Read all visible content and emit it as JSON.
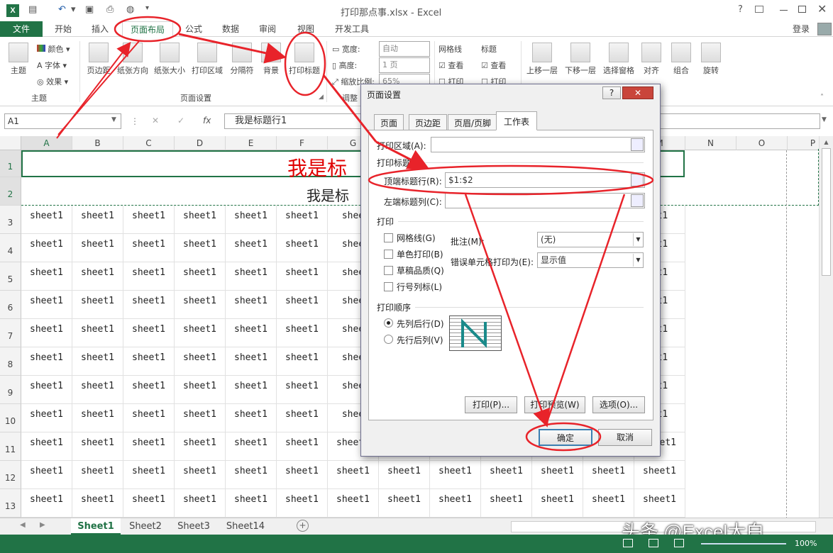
{
  "window": {
    "title": "打印那点事.xlsx - Excel",
    "help_label": "?",
    "login_label": "登录"
  },
  "ribbon_tabs": [
    {
      "label": "文件"
    },
    {
      "label": "开始"
    },
    {
      "label": "插入"
    },
    {
      "label": "页面布局"
    },
    {
      "label": "公式"
    },
    {
      "label": "数据"
    },
    {
      "label": "审阅"
    },
    {
      "label": "视图"
    },
    {
      "label": "开发工具"
    }
  ],
  "ribbon": {
    "theme_group": {
      "theme": "主题",
      "colors": "颜色",
      "fonts": "字体",
      "effects": "效果",
      "group_label": "主题"
    },
    "page_setup_group": {
      "margins": "页边距",
      "orientation": "纸张方向",
      "size": "纸张大小",
      "print_area": "打印区域",
      "breaks": "分隔符",
      "background": "背景",
      "print_titles": "打印标题",
      "group_label": "页面设置"
    },
    "scale_group": {
      "width_label": "宽度:",
      "width_value": "自动",
      "height_label": "高度:",
      "height_value": "1 页",
      "scale_label": "缩放比例:",
      "scale_value": "65%",
      "group_label": "调整"
    },
    "gridlines_group": {
      "title": "网格线",
      "view": "查看",
      "print": "打印"
    },
    "headings_group": {
      "title": "标题",
      "view": "查看",
      "print": "打印"
    },
    "arrange_group": {
      "bring_forward": "上移一层",
      "send_backward": "下移一层",
      "selection_pane": "选择窗格",
      "align": "对齐",
      "group": "组合",
      "rotate": "旋转"
    }
  },
  "formula_bar": {
    "name_box": "A1",
    "fx": "fx",
    "content": "我是标题行1"
  },
  "columns": [
    "A",
    "B",
    "C",
    "D",
    "E",
    "F",
    "G",
    "H",
    "I",
    "J",
    "K",
    "L",
    "M",
    "N",
    "O",
    "P"
  ],
  "rows": [
    "1",
    "2",
    "3",
    "4",
    "5",
    "6",
    "7",
    "8",
    "9",
    "10",
    "11",
    "12",
    "13"
  ],
  "cells": {
    "title_row1": "我是标",
    "title_row2": "我是标",
    "data": "sheet1",
    "truncated": "shee",
    "partial": "et1"
  },
  "dialog": {
    "title": "页面设置",
    "help": "?",
    "tabs": [
      {
        "label": "页面"
      },
      {
        "label": "页边距"
      },
      {
        "label": "页眉/页脚"
      },
      {
        "label": "工作表"
      }
    ],
    "print_area_label": "打印区域(A):",
    "print_titles_section": "打印标题",
    "rows_to_repeat_label": "顶端标题行(R):",
    "rows_to_repeat_value": "$1:$2",
    "cols_to_repeat_label": "左端标题列(C):",
    "print_section": "打印",
    "checkboxes": [
      {
        "label": "网格线(G)"
      },
      {
        "label": "单色打印(B)"
      },
      {
        "label": "草稿品质(Q)"
      },
      {
        "label": "行号列标(L)"
      }
    ],
    "comments_label": "批注(M):",
    "comments_value": "(无)",
    "cell_errors_label": "错误单元格打印为(E):",
    "cell_errors_value": "显示值",
    "page_order_section": "打印顺序",
    "radio_down_then_over": "先列后行(D)",
    "radio_over_then_down": "先行后列(V)",
    "btn_print": "打印(P)...",
    "btn_preview": "打印预览(W)",
    "btn_options": "选项(O)...",
    "btn_ok": "确定",
    "btn_cancel": "取消"
  },
  "sheet_tabs": [
    {
      "label": "Sheet1"
    },
    {
      "label": "Sheet2"
    },
    {
      "label": "Sheet3"
    },
    {
      "label": "Sheet14"
    }
  ],
  "watermark": "头条 @Excel大白",
  "status": {
    "zoom": "100%"
  },
  "colors": {
    "excel_green": "#217346",
    "annotation_red": "#e8232a",
    "title_red": "#e00000"
  }
}
